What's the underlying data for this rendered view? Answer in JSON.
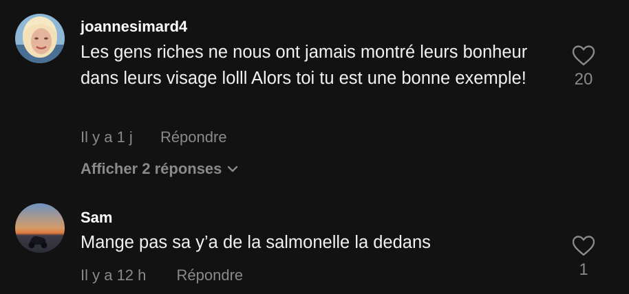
{
  "comments": [
    {
      "username": "joannesimard4",
      "text": "Les gens riches ne nous ont jamais montré leurs bonheur dans leurs visage lolll Alors toi tu est une bonne exemple!",
      "time": "Il y a 1 j",
      "reply_label": "Répondre",
      "like_count": "20",
      "view_replies_label": "Afficher 2 réponses"
    },
    {
      "username": "Sam",
      "text": "Mange pas sa y’a de la salmonelle la dedans",
      "time": "Il y a 12 h",
      "reply_label": "Répondre",
      "like_count": "1"
    }
  ],
  "colors": {
    "background": "#121212",
    "primary_text": "#f1f1f1",
    "secondary_text": "#8a8a8a"
  },
  "icons": {
    "like": "heart-outline-icon",
    "expand": "chevron-down-icon"
  }
}
